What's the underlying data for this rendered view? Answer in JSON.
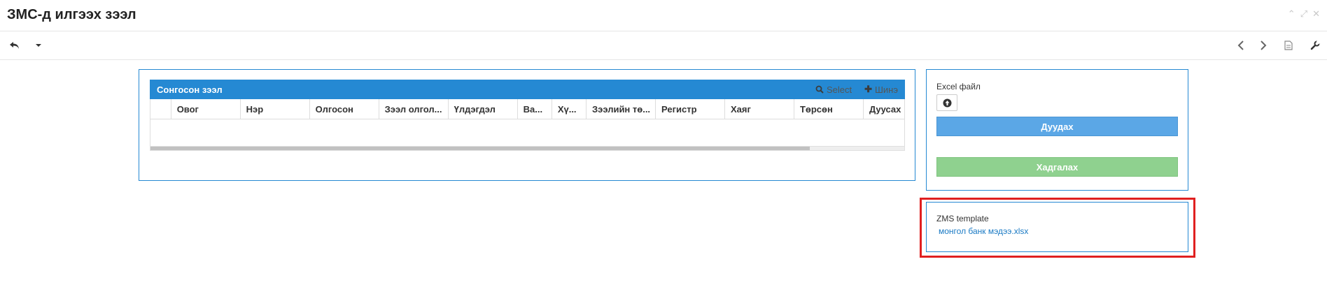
{
  "window": {
    "title": "ЗМС-д илгээх зээл",
    "controls": [
      "collapse-icon",
      "maximize-icon",
      "close-icon"
    ]
  },
  "toolbar": {
    "left": [
      "undo-icon",
      "dropdown-caret-icon"
    ],
    "right": [
      "prev-icon",
      "next-icon",
      "document-icon",
      "wrench-icon"
    ]
  },
  "grid": {
    "title": "Сонгосон зээл",
    "select_label": "Select",
    "new_label": "Шинэ",
    "columns": [
      "Овог",
      "Нэр",
      "Олгосон",
      "Зээл олгол...",
      "Үлдэгдэл",
      "Ва...",
      "Хү...",
      "Зээлийн тө...",
      "Регистр",
      "Хаяг",
      "Төрсөн",
      "Дуусах"
    ]
  },
  "upload": {
    "label": "Excel файл",
    "import_label": "Дуудах",
    "save_label": "Хадгалах"
  },
  "template": {
    "label": "ZMS template",
    "link": "монгол банк мэдээ.xlsx"
  },
  "colors": {
    "accent": "#2589d3",
    "import_button": "#5ba7e6",
    "save_button": "#8fd18f",
    "highlight": "#e02020"
  }
}
